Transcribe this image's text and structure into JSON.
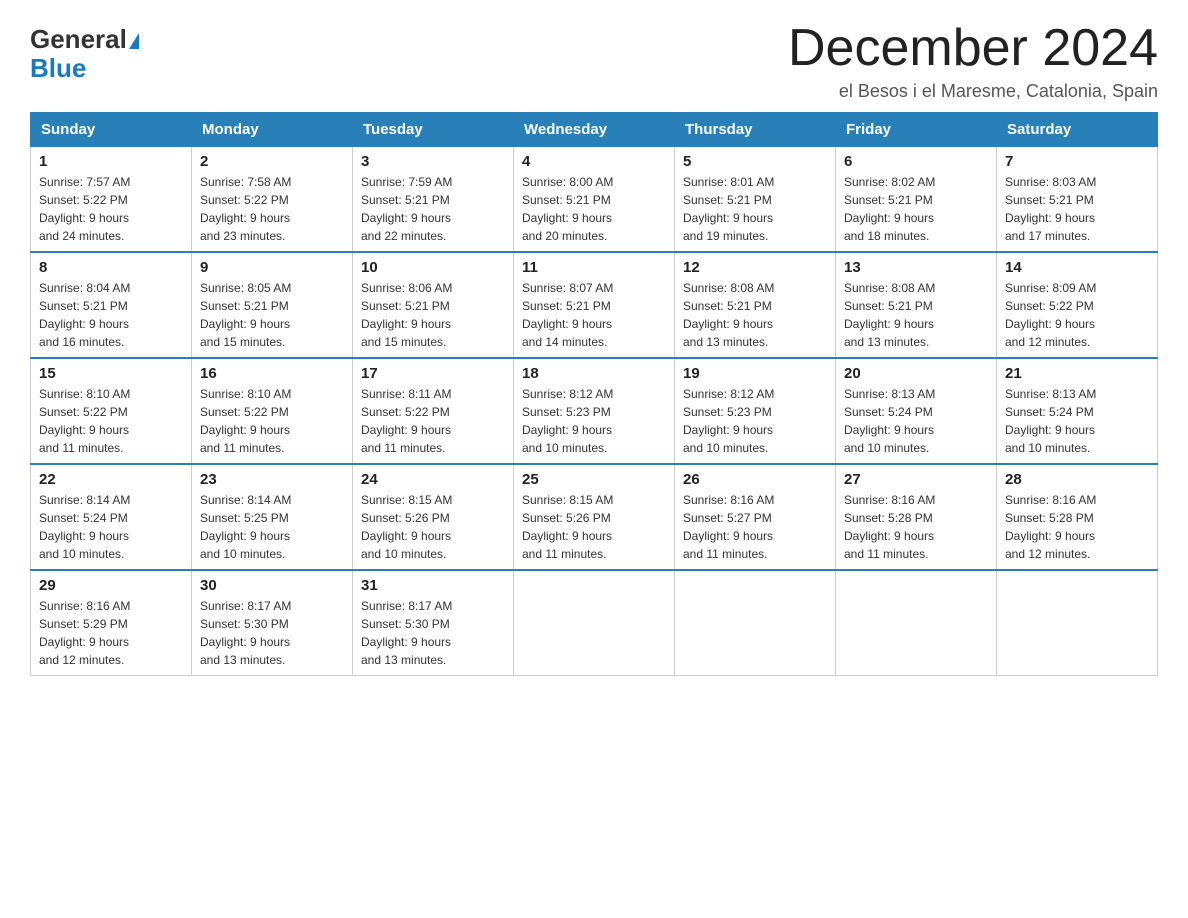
{
  "logo": {
    "general": "General",
    "blue": "Blue"
  },
  "title": "December 2024",
  "location": "el Besos i el Maresme, Catalonia, Spain",
  "days_of_week": [
    "Sunday",
    "Monday",
    "Tuesday",
    "Wednesday",
    "Thursday",
    "Friday",
    "Saturday"
  ],
  "weeks": [
    [
      {
        "day": "1",
        "sunrise": "7:57 AM",
        "sunset": "5:22 PM",
        "daylight": "9 hours and 24 minutes."
      },
      {
        "day": "2",
        "sunrise": "7:58 AM",
        "sunset": "5:22 PM",
        "daylight": "9 hours and 23 minutes."
      },
      {
        "day": "3",
        "sunrise": "7:59 AM",
        "sunset": "5:21 PM",
        "daylight": "9 hours and 22 minutes."
      },
      {
        "day": "4",
        "sunrise": "8:00 AM",
        "sunset": "5:21 PM",
        "daylight": "9 hours and 20 minutes."
      },
      {
        "day": "5",
        "sunrise": "8:01 AM",
        "sunset": "5:21 PM",
        "daylight": "9 hours and 19 minutes."
      },
      {
        "day": "6",
        "sunrise": "8:02 AM",
        "sunset": "5:21 PM",
        "daylight": "9 hours and 18 minutes."
      },
      {
        "day": "7",
        "sunrise": "8:03 AM",
        "sunset": "5:21 PM",
        "daylight": "9 hours and 17 minutes."
      }
    ],
    [
      {
        "day": "8",
        "sunrise": "8:04 AM",
        "sunset": "5:21 PM",
        "daylight": "9 hours and 16 minutes."
      },
      {
        "day": "9",
        "sunrise": "8:05 AM",
        "sunset": "5:21 PM",
        "daylight": "9 hours and 15 minutes."
      },
      {
        "day": "10",
        "sunrise": "8:06 AM",
        "sunset": "5:21 PM",
        "daylight": "9 hours and 15 minutes."
      },
      {
        "day": "11",
        "sunrise": "8:07 AM",
        "sunset": "5:21 PM",
        "daylight": "9 hours and 14 minutes."
      },
      {
        "day": "12",
        "sunrise": "8:08 AM",
        "sunset": "5:21 PM",
        "daylight": "9 hours and 13 minutes."
      },
      {
        "day": "13",
        "sunrise": "8:08 AM",
        "sunset": "5:21 PM",
        "daylight": "9 hours and 13 minutes."
      },
      {
        "day": "14",
        "sunrise": "8:09 AM",
        "sunset": "5:22 PM",
        "daylight": "9 hours and 12 minutes."
      }
    ],
    [
      {
        "day": "15",
        "sunrise": "8:10 AM",
        "sunset": "5:22 PM",
        "daylight": "9 hours and 11 minutes."
      },
      {
        "day": "16",
        "sunrise": "8:10 AM",
        "sunset": "5:22 PM",
        "daylight": "9 hours and 11 minutes."
      },
      {
        "day": "17",
        "sunrise": "8:11 AM",
        "sunset": "5:22 PM",
        "daylight": "9 hours and 11 minutes."
      },
      {
        "day": "18",
        "sunrise": "8:12 AM",
        "sunset": "5:23 PM",
        "daylight": "9 hours and 10 minutes."
      },
      {
        "day": "19",
        "sunrise": "8:12 AM",
        "sunset": "5:23 PM",
        "daylight": "9 hours and 10 minutes."
      },
      {
        "day": "20",
        "sunrise": "8:13 AM",
        "sunset": "5:24 PM",
        "daylight": "9 hours and 10 minutes."
      },
      {
        "day": "21",
        "sunrise": "8:13 AM",
        "sunset": "5:24 PM",
        "daylight": "9 hours and 10 minutes."
      }
    ],
    [
      {
        "day": "22",
        "sunrise": "8:14 AM",
        "sunset": "5:24 PM",
        "daylight": "9 hours and 10 minutes."
      },
      {
        "day": "23",
        "sunrise": "8:14 AM",
        "sunset": "5:25 PM",
        "daylight": "9 hours and 10 minutes."
      },
      {
        "day": "24",
        "sunrise": "8:15 AM",
        "sunset": "5:26 PM",
        "daylight": "9 hours and 10 minutes."
      },
      {
        "day": "25",
        "sunrise": "8:15 AM",
        "sunset": "5:26 PM",
        "daylight": "9 hours and 11 minutes."
      },
      {
        "day": "26",
        "sunrise": "8:16 AM",
        "sunset": "5:27 PM",
        "daylight": "9 hours and 11 minutes."
      },
      {
        "day": "27",
        "sunrise": "8:16 AM",
        "sunset": "5:28 PM",
        "daylight": "9 hours and 11 minutes."
      },
      {
        "day": "28",
        "sunrise": "8:16 AM",
        "sunset": "5:28 PM",
        "daylight": "9 hours and 12 minutes."
      }
    ],
    [
      {
        "day": "29",
        "sunrise": "8:16 AM",
        "sunset": "5:29 PM",
        "daylight": "9 hours and 12 minutes."
      },
      {
        "day": "30",
        "sunrise": "8:17 AM",
        "sunset": "5:30 PM",
        "daylight": "9 hours and 13 minutes."
      },
      {
        "day": "31",
        "sunrise": "8:17 AM",
        "sunset": "5:30 PM",
        "daylight": "9 hours and 13 minutes."
      },
      null,
      null,
      null,
      null
    ]
  ],
  "labels": {
    "sunrise": "Sunrise:",
    "sunset": "Sunset:",
    "daylight": "Daylight:"
  }
}
